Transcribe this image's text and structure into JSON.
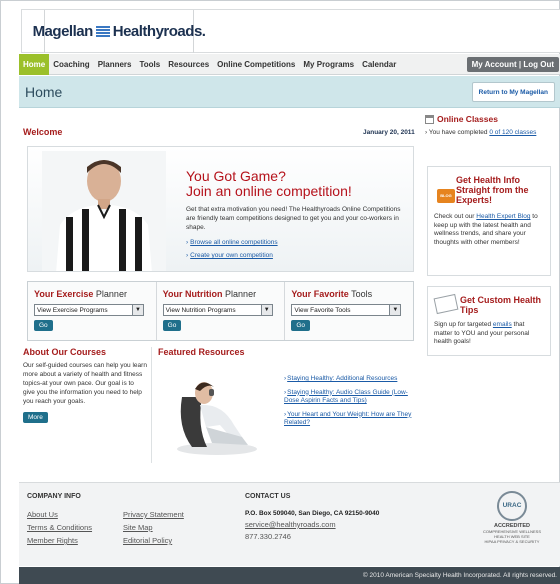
{
  "brand": {
    "logo_left": "Magellan",
    "logo_right": "Healthyroads."
  },
  "nav": {
    "items": [
      "Home",
      "Coaching",
      "Planners",
      "Tools",
      "Resources",
      "Online Competitions",
      "My Programs",
      "Calendar"
    ],
    "account": "My Account",
    "logout": "Log Out",
    "sep": "|"
  },
  "page": {
    "title": "Home",
    "return_button": "Return to My Magellan",
    "welcome": "Welcome",
    "date": "January 20, 2011"
  },
  "hero": {
    "title1": "You Got Game?",
    "title2": "Join an online competition!",
    "desc": "Get that extra motivation you need! The Healthyroads Online Competitions are friendly team competitions designed to get you and your co-workers in shape.",
    "link1": "Browse all online competitions",
    "link2": "Create your own competition"
  },
  "planners": [
    {
      "prefix": "Your",
      "bold": "Exercise",
      "suffix": "Planner",
      "select": "View Exercise Programs",
      "go": "Go"
    },
    {
      "prefix": "Your",
      "bold": "Nutrition",
      "suffix": "Planner",
      "select": "View Nutrition Programs",
      "go": "Go"
    },
    {
      "prefix": "Your",
      "bold": "Favorite",
      "suffix": "Tools",
      "select": "View Favorite Tools",
      "go": "Go"
    }
  ],
  "courses": {
    "title": "About Our Courses",
    "text": "Our self-guided courses can help you learn more about a variety of health and fitness topics-at your own pace. Our goal is to give you the information you need to help you reach your goals.",
    "more": "More"
  },
  "featured": {
    "title": "Featured Resources",
    "items": [
      "Staying Healthy: Additional Resources",
      "Staying Healthy: Audio Class Guide (Low-Dose Aspirin Facts and Tips)",
      "Your Heart and Your Weight: How are They Related?"
    ]
  },
  "online_classes": {
    "title": "Online Classes",
    "text_pre": "You have completed",
    "link": "0 of 120 classes"
  },
  "health_info": {
    "badge": "BLOG",
    "title": "Get Health Info Straight from the Experts!",
    "text_pre": "Check out our",
    "link": "Health Expert Blog",
    "text_post": "to keep up with the latest health and wellness trends, and share your thoughts with other members!"
  },
  "health_tips": {
    "title": "Get Custom Health Tips",
    "text_pre": "Sign up for targeted",
    "link": "emails",
    "text_post": "that matter to YOU and your personal health goals!"
  },
  "footer": {
    "company_title": "COMPANY INFO",
    "links": [
      "About Us",
      "Privacy Statement",
      "Terms & Conditions",
      "Site Map",
      "Member Rights",
      "Editorial Policy"
    ],
    "contact_title": "CONTACT US",
    "address": "P.O. Box 509040, San Diego, CA 92150-9040",
    "email": "service@healthyroads.com",
    "phone": "877.330.2746",
    "urac_seal": "URAC",
    "urac_accredited": "ACCREDITED",
    "urac_line1": "COMPREHENSIVE WELLNESS",
    "urac_line2": "HEALTH WEB SITE",
    "urac_line3": "HIPAA PRIVACY & SECURITY",
    "copyright": "© 2010 American Specialty Health Incorporated. All rights reserved."
  }
}
